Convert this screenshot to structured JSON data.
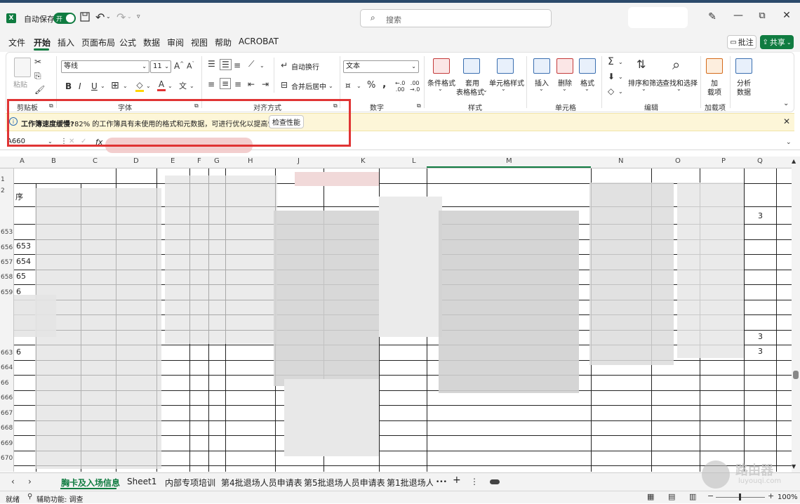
{
  "titlebar": {
    "autosave_label": "自动保存",
    "autosave_state": "开",
    "search_placeholder": "搜索"
  },
  "menu": {
    "tabs": [
      "文件",
      "开始",
      "插入",
      "页面布局",
      "公式",
      "数据",
      "审阅",
      "视图",
      "帮助",
      "ACROBAT"
    ],
    "active_tab": "开始",
    "comment_label": "批注",
    "share_label": "共享"
  },
  "ribbon": {
    "clipboard": {
      "paste_label": "粘贴",
      "group_label": "剪贴板"
    },
    "font": {
      "font_name": "等线",
      "font_size": "11",
      "group_label": "字体"
    },
    "alignment": {
      "wrap_label": "自动换行",
      "merge_label": "合并后居中",
      "group_label": "对齐方式"
    },
    "number": {
      "format": "文本",
      "group_label": "数字"
    },
    "styles": {
      "conditional_label": "条件格式",
      "table_label_1": "套用",
      "table_label_2": "表格格式",
      "cell_styles_label": "单元格样式",
      "group_label": "样式"
    },
    "cells": {
      "insert_label": "插入",
      "delete_label": "删除",
      "format_label": "格式",
      "group_label": "单元格"
    },
    "editing": {
      "sort_label": "排序和筛选",
      "find_label": "查找和选择",
      "group_label": "编辑"
    },
    "addins": {
      "label_1": "加",
      "label_2": "载项",
      "group_label": "加载项"
    },
    "analysis": {
      "label_1": "分析",
      "label_2": "数据"
    }
  },
  "notification": {
    "title": "工作簿速度缓慢?",
    "message": "82% 的工作簿具有未使用的格式和元数据，可进行优化以提高性能。",
    "button_label": "检查性能"
  },
  "formula_bar": {
    "name_box": "A660",
    "fx": "fx"
  },
  "grid": {
    "columns": [
      "A",
      "B",
      "C",
      "D",
      "E",
      "F",
      "G",
      "H",
      "J",
      "K",
      "L",
      "M",
      "N",
      "O",
      "P",
      "Q"
    ],
    "rows": [
      "1",
      "2",
      "",
      "653",
      "656",
      "657",
      "658",
      "659",
      "",
      "",
      "",
      "663",
      "664",
      "66",
      "666",
      "667",
      "668",
      "669",
      "670"
    ],
    "visible_cells": {
      "b_653": "653",
      "b_654": "654",
      "b_65a": "65",
      "b_65b": "6",
      "b_663": "6",
      "q_row1": "3",
      "q_row2": "3",
      "q_row3": "3",
      "header_fragment": "序"
    }
  },
  "sheets": {
    "tabs": [
      "胸卡及入场信息",
      "Sheet1",
      "内部专项培训",
      "第4批退场人员申请表",
      "第5批退场人员申请表",
      "第1批退场人员"
    ],
    "active": "胸卡及入场信息",
    "more": "•••",
    "add": "+"
  },
  "statusbar": {
    "ready": "就绪",
    "accessibility": "辅助功能: 调查",
    "zoom": "100%"
  },
  "watermark": {
    "brand": "路由器",
    "url": "luyouqi.com"
  },
  "colors": {
    "excel_green": "#107c41",
    "highlight_red": "#e03434",
    "notify_bg": "#fdf6d8"
  }
}
